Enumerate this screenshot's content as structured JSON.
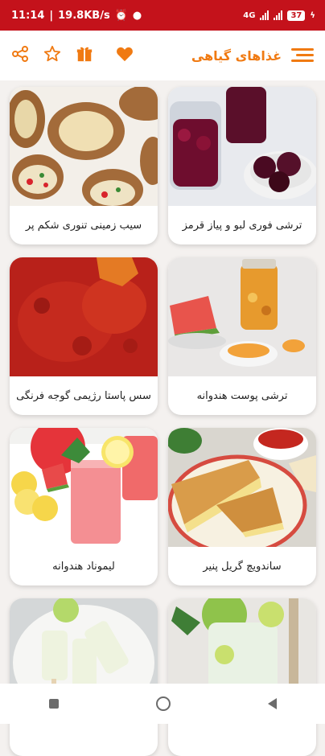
{
  "status": {
    "time": "11:14",
    "speed": "19.8KB/s",
    "network": "4G",
    "battery": "37"
  },
  "app_bar": {
    "title": "غذاهای گیاهی"
  },
  "recipes": [
    {
      "title": "ترشی فوری لبو و پیاز قرمز"
    },
    {
      "title": "سیب زمینی تنوری شکم پر"
    },
    {
      "title": "ترشی پوست هندوانه"
    },
    {
      "title": "سس پاستا رژیمی گوجه فرنگی"
    },
    {
      "title": "ساندویچ گریل پنیر"
    },
    {
      "title": "لیموناد هندوانه"
    },
    {
      "title": ""
    },
    {
      "title": ""
    }
  ]
}
